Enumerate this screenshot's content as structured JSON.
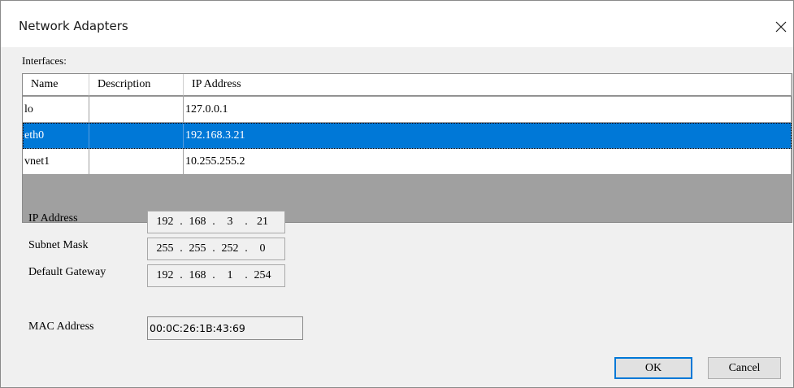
{
  "window": {
    "title": "Network Adapters"
  },
  "interfaces_label": "Interfaces:",
  "table": {
    "columns": [
      "Name",
      "Description",
      "IP Address"
    ],
    "rows": [
      {
        "name": "lo",
        "description": "",
        "ip": "127.0.0.1",
        "selected": false
      },
      {
        "name": "eth0",
        "description": "",
        "ip": "192.168.3.21",
        "selected": true
      },
      {
        "name": "vnet1",
        "description": "",
        "ip": "10.255.255.2",
        "selected": false
      }
    ]
  },
  "fields": {
    "ip_address": {
      "label": "IP Address",
      "octets": [
        "192",
        "168",
        "3",
        "21"
      ]
    },
    "subnet_mask": {
      "label": "Subnet Mask",
      "octets": [
        "255",
        "255",
        "252",
        "0"
      ]
    },
    "default_gateway": {
      "label": "Default Gateway",
      "octets": [
        "192",
        "168",
        "1",
        "254"
      ]
    },
    "mac_address": {
      "label": "MAC Address",
      "value": "00:0C:26:1B:43:69"
    }
  },
  "buttons": {
    "ok": "OK",
    "cancel": "Cancel"
  },
  "colors": {
    "selection": "#0078d7",
    "dialog_bg": "#f0f0f0",
    "grid_empty": "#a0a0a0"
  }
}
